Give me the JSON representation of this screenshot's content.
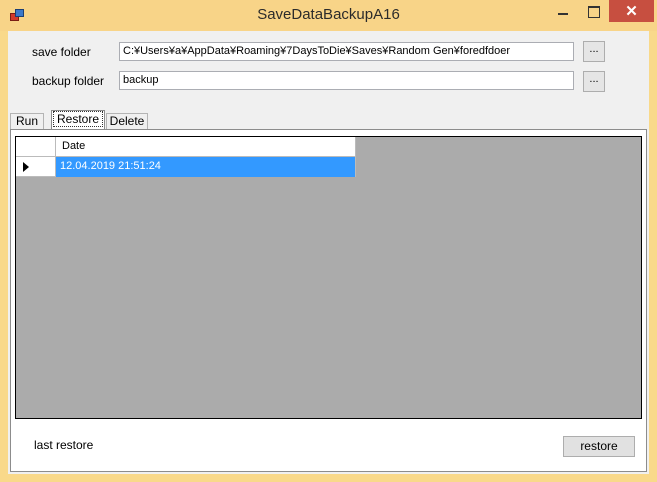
{
  "window": {
    "title": "SaveDataBackupA16",
    "close_glyph": "✕"
  },
  "form": {
    "save_folder_label": "save folder",
    "save_folder_value": "C:¥Users¥a¥AppData¥Roaming¥7DaysToDie¥Saves¥Random Gen¥foredfdoer",
    "backup_folder_label": "backup folder",
    "backup_folder_value": "backup",
    "browse_label": "..."
  },
  "tabs": [
    {
      "label": "Run"
    },
    {
      "label": "Restore"
    },
    {
      "label": "Delete"
    }
  ],
  "grid": {
    "columns": [
      "Date"
    ],
    "rows": [
      {
        "date": "12.04.2019 21:51:24",
        "selected": true
      }
    ]
  },
  "footer": {
    "last_restore_label": "last restore",
    "restore_button": "restore"
  },
  "colors": {
    "title_bar": "#f8d488",
    "selection": "#3399ff",
    "grid_background": "#ababab",
    "close_button": "#c74f40"
  },
  "icons": {
    "app": "app-icon",
    "row_indicator": "row-pointer-icon"
  }
}
